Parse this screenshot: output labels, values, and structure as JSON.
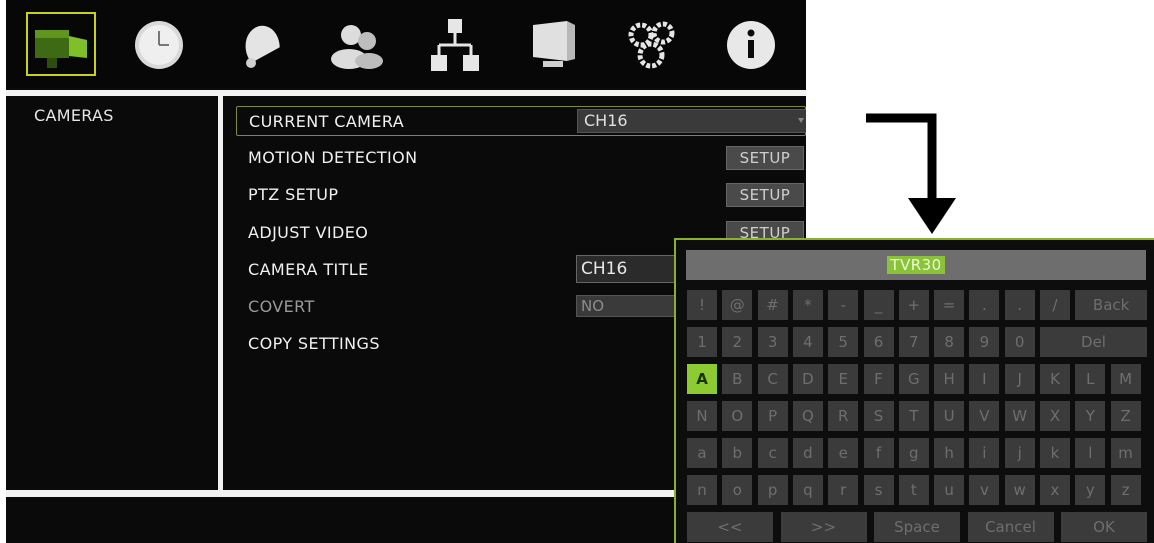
{
  "menu": {
    "tabs": [
      {
        "name": "camera-icon",
        "active": true
      },
      {
        "name": "clock-icon",
        "active": false
      },
      {
        "name": "bell-icon",
        "active": false
      },
      {
        "name": "users-icon",
        "active": false
      },
      {
        "name": "network-icon",
        "active": false
      },
      {
        "name": "display-icon",
        "active": false
      },
      {
        "name": "gears-icon",
        "active": false
      },
      {
        "name": "info-icon",
        "active": false
      }
    ]
  },
  "sidebar": {
    "title": "CAMERAS"
  },
  "settings": {
    "current_camera": {
      "label": "CURRENT CAMERA",
      "value": "CH16"
    },
    "motion_detection": {
      "label": "MOTION DETECTION",
      "button": "SETUP"
    },
    "ptz_setup": {
      "label": "PTZ SETUP",
      "button": "SETUP"
    },
    "adjust_video": {
      "label": "ADJUST VIDEO",
      "button": "SETUP"
    },
    "camera_title": {
      "label": "CAMERA TITLE",
      "value": "CH16"
    },
    "covert": {
      "label": "COVERT",
      "value": "NO"
    },
    "copy_settings": {
      "label": "COPY SETTINGS"
    }
  },
  "keyboard": {
    "input_value": "TVR30",
    "rows": [
      [
        "!",
        "@",
        "#",
        "*",
        "-",
        "_",
        "+",
        "=",
        ".",
        ".",
        "/",
        "Back"
      ],
      [
        "1",
        "2",
        "3",
        "4",
        "5",
        "6",
        "7",
        "8",
        "9",
        "0",
        "Del"
      ],
      [
        "A",
        "B",
        "C",
        "D",
        "E",
        "F",
        "G",
        "H",
        "I",
        "J",
        "K",
        "L",
        "M"
      ],
      [
        "N",
        "O",
        "P",
        "Q",
        "R",
        "S",
        "T",
        "U",
        "V",
        "W",
        "X",
        "Y",
        "Z"
      ],
      [
        "a",
        "b",
        "c",
        "d",
        "e",
        "f",
        "g",
        "h",
        "i",
        "j",
        "k",
        "l",
        "m"
      ],
      [
        "n",
        "o",
        "p",
        "q",
        "r",
        "s",
        "t",
        "u",
        "v",
        "w",
        "x",
        "y",
        "z"
      ]
    ],
    "bottom_row": [
      "<<",
      ">>",
      "Space",
      "Cancel",
      "OK"
    ],
    "selected_key": "A"
  },
  "colors": {
    "accent": "#8ccc32",
    "tab_highlight": "#c7d21e"
  }
}
